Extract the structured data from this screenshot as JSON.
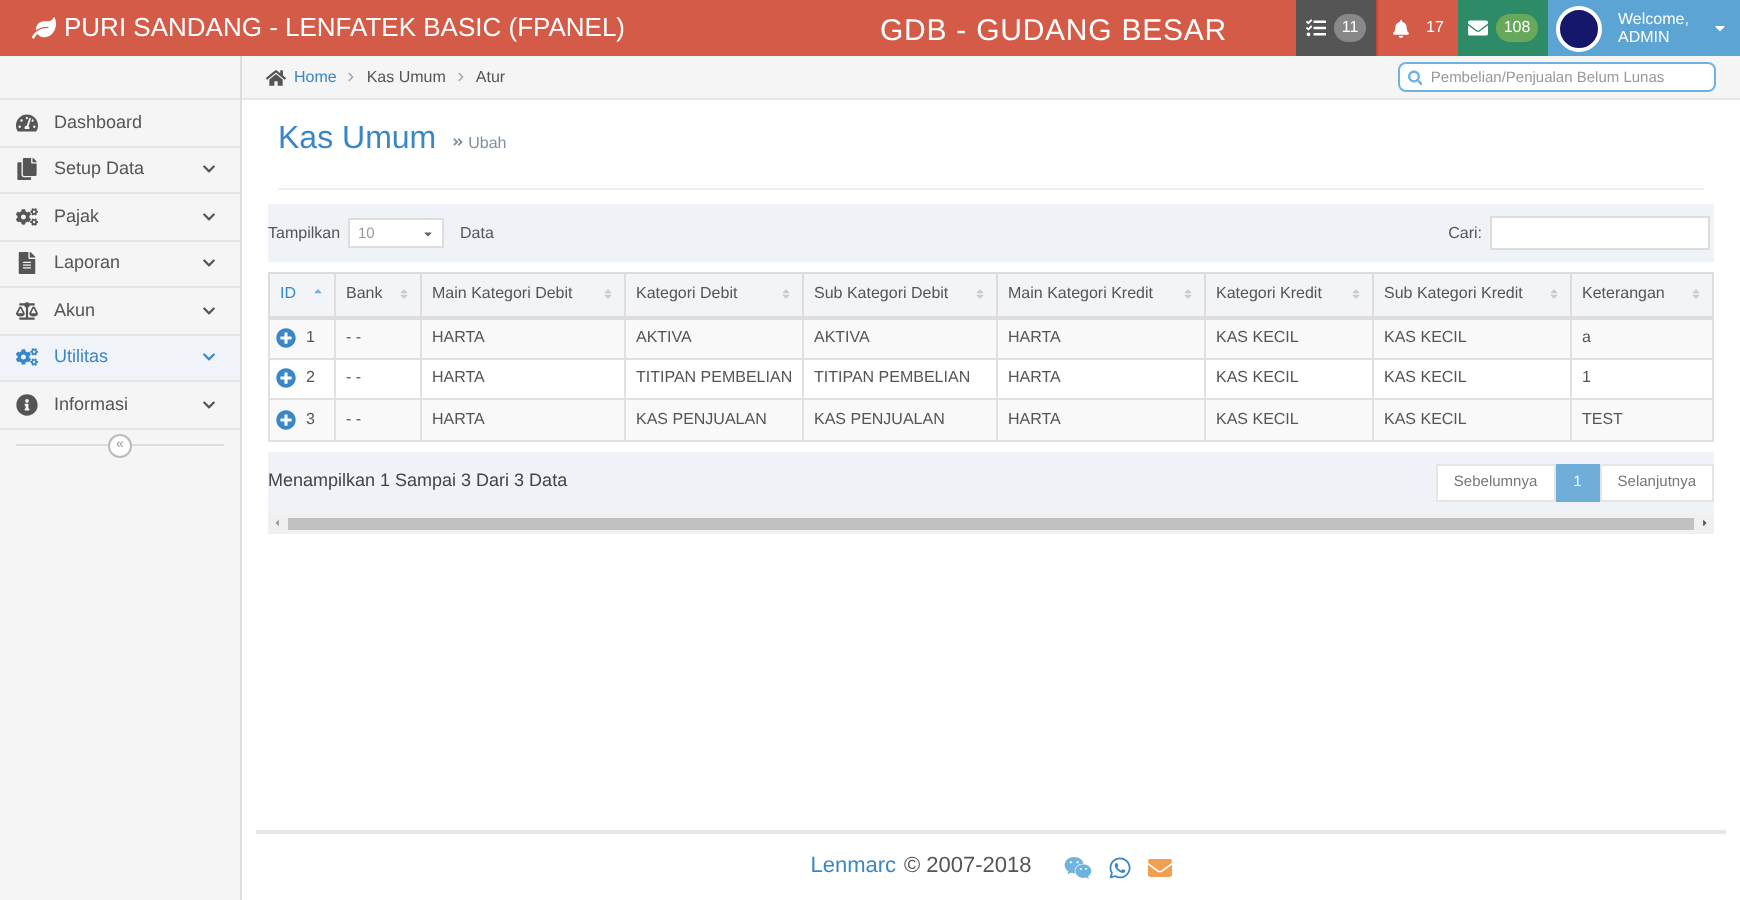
{
  "header": {
    "brand": "PURI SANDANG - LENFATEK BASIC (FPANEL)",
    "warehouse": "GDB - GUDANG BESAR",
    "tasks_count": "11",
    "notifications_count": "17",
    "messages_count": "108",
    "welcome": "Welcome,",
    "user": "ADMIN"
  },
  "breadcrumb": [
    "Home",
    "Kas Umum",
    "Atur"
  ],
  "search": {
    "placeholder": "Pembelian/Penjualan Belum Lunas"
  },
  "sidebar": {
    "items": [
      {
        "label": "Dashboard",
        "selected": false,
        "has_submenu": false
      },
      {
        "label": "Setup Data",
        "selected": false,
        "has_submenu": true
      },
      {
        "label": "Pajak",
        "selected": false,
        "has_submenu": true
      },
      {
        "label": "Laporan",
        "selected": false,
        "has_submenu": true
      },
      {
        "label": "Akun",
        "selected": false,
        "has_submenu": true
      },
      {
        "label": "Utilitas",
        "selected": true,
        "has_submenu": true
      },
      {
        "label": "Informasi",
        "selected": false,
        "has_submenu": true
      }
    ],
    "collapse": "«"
  },
  "page": {
    "title": "Kas Umum",
    "subtitle": "Ubah"
  },
  "table": {
    "length_label": "Tampilkan",
    "length_value": "10",
    "length_suffix": "Data",
    "search_label": "Cari:",
    "columns": [
      {
        "label": "ID",
        "sorted": true
      },
      {
        "label": "Bank",
        "sorted": false
      },
      {
        "label": "Main Kategori Debit",
        "sorted": false
      },
      {
        "label": "Kategori Debit",
        "sorted": false
      },
      {
        "label": "Sub Kategori Debit",
        "sorted": false
      },
      {
        "label": "Main Kategori Kredit",
        "sorted": false
      },
      {
        "label": "Kategori Kredit",
        "sorted": false
      },
      {
        "label": "Sub Kategori Kredit",
        "sorted": false
      },
      {
        "label": "Keterangan",
        "sorted": false
      }
    ],
    "rows": [
      [
        "1",
        "- -",
        "HARTA",
        "AKTIVA",
        "AKTIVA",
        "HARTA",
        "KAS KECIL",
        "KAS KECIL",
        "a"
      ],
      [
        "2",
        "- -",
        "HARTA",
        "TITIPAN PEMBELIAN",
        "TITIPAN PEMBELIAN",
        "HARTA",
        "KAS KECIL",
        "KAS KECIL",
        "1"
      ],
      [
        "3",
        "- -",
        "HARTA",
        "KAS PENJUALAN",
        "KAS PENJUALAN",
        "HARTA",
        "KAS KECIL",
        "KAS KECIL",
        "TEST"
      ]
    ],
    "info": "Menampilkan 1 Sampai 3 Dari 3 Data",
    "pagination": [
      {
        "label": "Sebelumnya",
        "selected": false
      },
      {
        "label": "1",
        "selected": true
      },
      {
        "label": "Selanjutnya",
        "selected": false
      }
    ]
  },
  "footer": {
    "brand": "Lenmarc",
    "copyright": "© 2007-2018"
  }
}
